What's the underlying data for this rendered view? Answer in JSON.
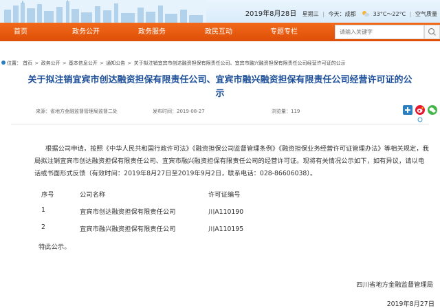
{
  "header": {
    "date": "2019年8月28日",
    "weekday": "星期三",
    "today_label": "今天：",
    "city": "成都",
    "weather_range": "33°C～22°C",
    "air_quality_label": "空气质量"
  },
  "nav": {
    "items": [
      "首页",
      "政务公开",
      "政务服务",
      "政民互动",
      "专题专栏"
    ],
    "search_placeholder": "请输入关键字"
  },
  "breadcrumb": {
    "label": "位置：",
    "items": [
      "首页",
      "政务公开",
      "基本信息公开",
      "通知公告"
    ],
    "current": "关于拟注销宜宾市创达融资担保有限责任公司、宜宾市融兴融资担保有限责任公司经营许可证的公示",
    "separator": ">"
  },
  "article": {
    "title": "关于拟注销宜宾市创达融资担保有限责任公司、宜宾市融兴融资担保有限责任公司经营许可证的公示",
    "source": "来源：省地方金融监督管理局监督二处",
    "publish_time": "发布时间：2019-08-27",
    "views": "浏览量：119",
    "paragraph1": "根据公司申请，按照《中华人民共和国行政许可法》《融资担保公司监督管理条例》《融资担保业务经营许可证管理办法》等相关规定，我局拟注销宜宾市创达融资担保有限责任公司、宜宾市融兴融资担保有限责任公司的经营许可证。现将有关情况公示如下，如有异议，请以电话或书面形式反馈（有效时间：2019年8月27日至2019年9月2日，联系电话：028-86606038）。",
    "table": {
      "headers": [
        "序号",
        "公司名称",
        "许可证编号"
      ],
      "rows": [
        [
          "1",
          "宜宾市创达融资担保有限责任公司",
          "川A110190"
        ],
        [
          "2",
          "宜宾市融兴融资担保有限责任公司",
          "川A110195"
        ]
      ]
    },
    "closing": "特此公示。",
    "signature_org": "四川省地方金融监督管理局",
    "signature_date": "2019年8月27日"
  },
  "colors": {
    "nav_bg": "#e8590c",
    "title": "#1d4f99",
    "crumb_icon": "#2a7fc1"
  },
  "icons": {
    "share": [
      "plus-share-icon",
      "sina-weibo-icon",
      "wechat-icon",
      "tencent-weibo-icon"
    ],
    "header": [
      "sun-cloud-icon"
    ]
  }
}
